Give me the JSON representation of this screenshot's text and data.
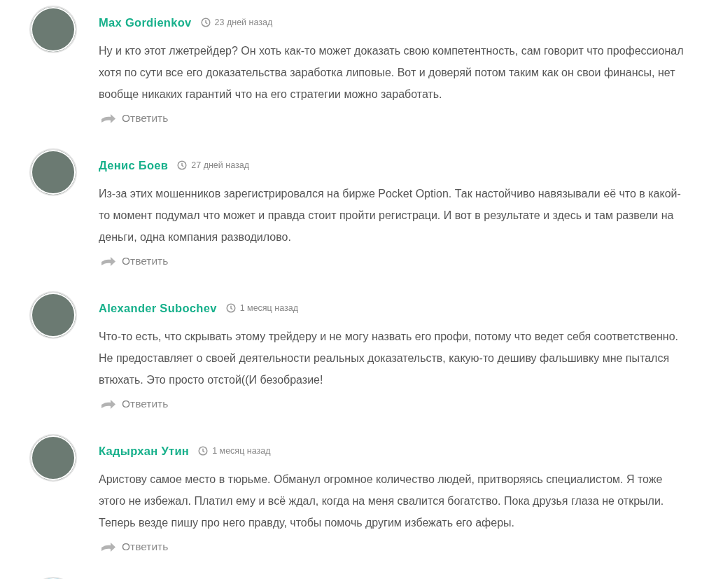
{
  "comments": [
    {
      "kind": "comment",
      "author": "Max Gordienkov",
      "time": "23 дней назад",
      "text": "Ну и кто этот лжетрейдер? Он хоть как-то может доказать свою компетентность, сам говорит что профессионал хотя по сути все его доказательства заработка липовые. Вот и доверяй потом таким как он свои финансы, нет вообще никаких гарантий что на его стратегии можно заработать.",
      "reply": "Ответить"
    },
    {
      "kind": "comment",
      "author": "Денис Боев",
      "time": "27 дней назад",
      "text": "Из-за этих мошенников зарегистрировался на бирже Pocket Option. Так настойчиво навязывали её что в какой-то момент подумал что может и правда стоит пройти регистраци. И вот в результате и здесь и там развели на деньги, одна компания разводилово.",
      "reply": "Ответить"
    },
    {
      "kind": "comment",
      "author": "Alexander Subochev",
      "time": "1 месяц назад",
      "text": "Что-то есть, что скрывать этому трейдеру и не могу назвать его профи, потому что ведет себя соответственно. Не предоставляет о своей деятельности реальных доказательств, какую-то дешиву фальшивку мне пытался втюхать. Это просто отстой((И безобразие!",
      "reply": "Ответить"
    },
    {
      "kind": "comment",
      "author": "Кадырхан Утин",
      "time": "1 месяц назад",
      "text": "Аристову самое место в тюрьме. Обманул огромное количество людей, притворяясь специалистом. Я тоже этого не избежал. Платил ему и всё ждал, когда на меня свалится богатство. Пока друзья глаза не открыли. Теперь везде пишу про него правду, чтобы помочь другим избежать его аферы.",
      "reply": "Ответить"
    },
    {
      "kind": "partial"
    }
  ]
}
